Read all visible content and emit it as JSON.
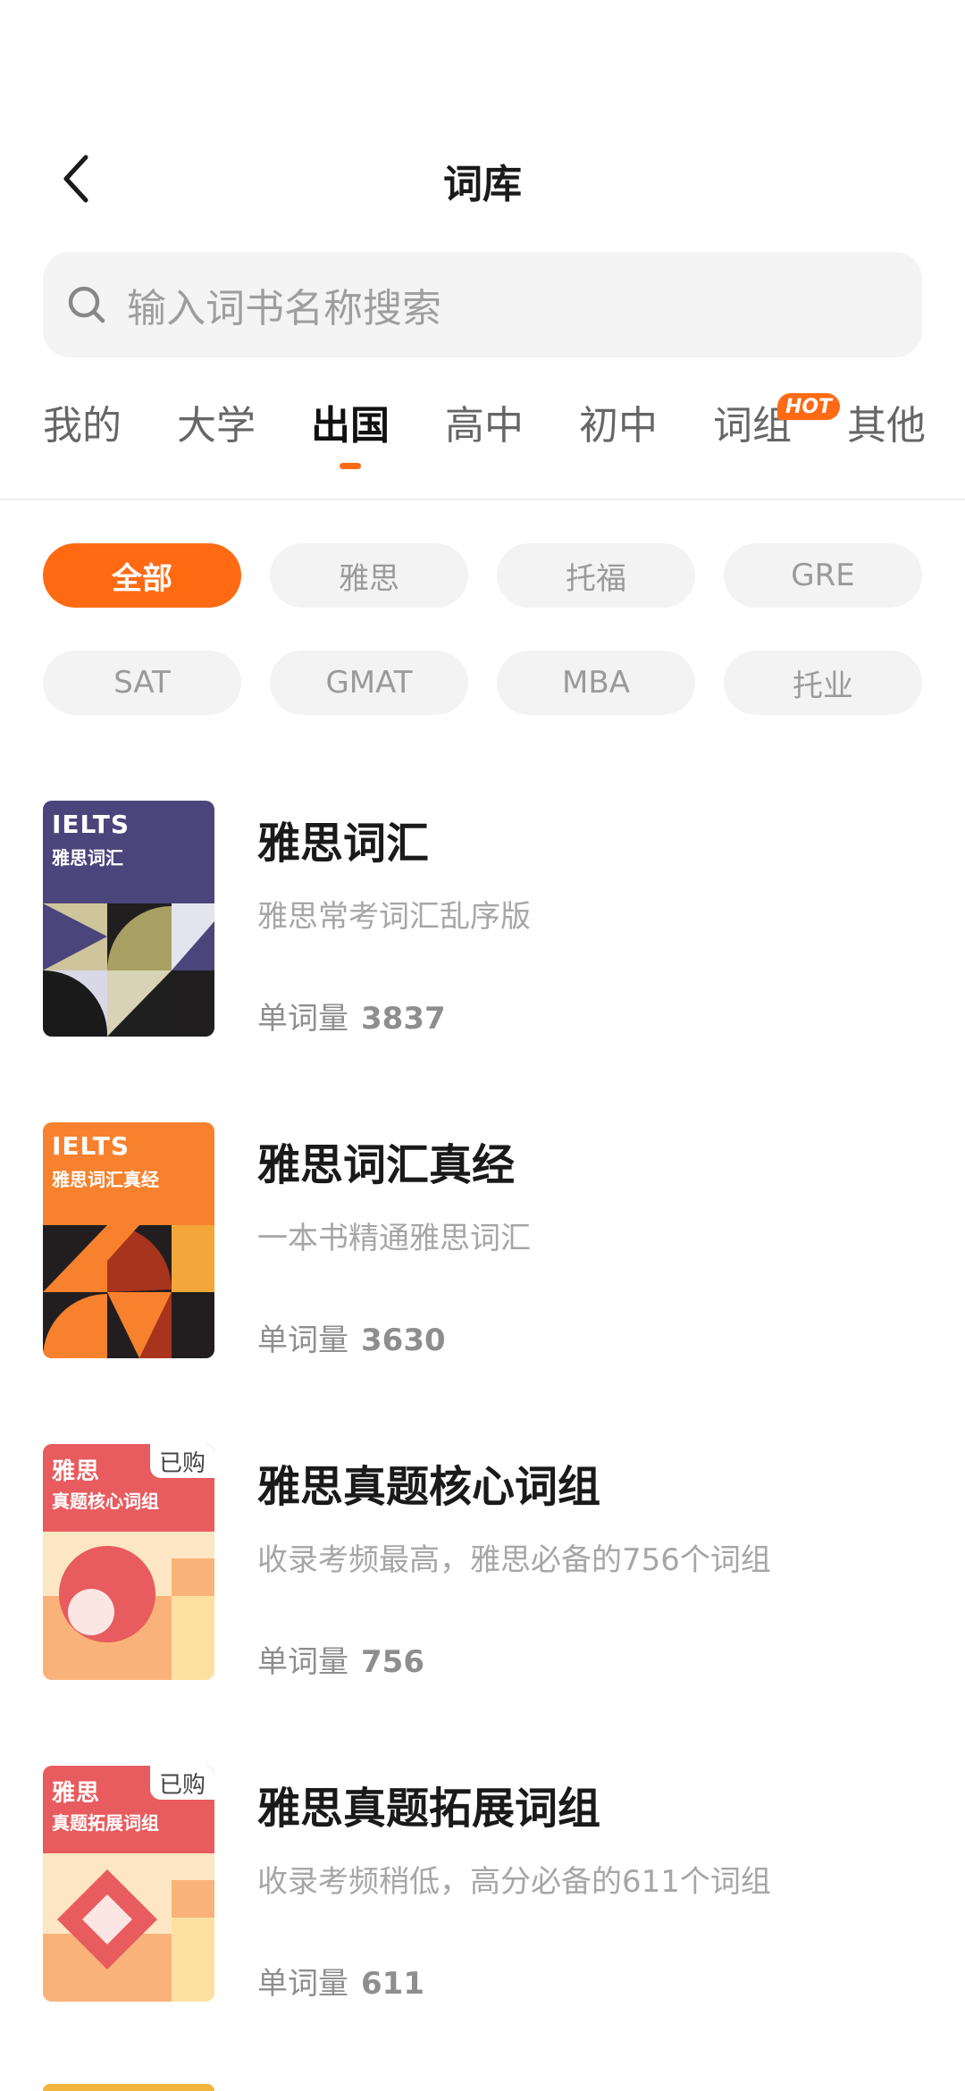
{
  "header": {
    "title": "词库",
    "back_icon": "chevron-left-icon"
  },
  "search": {
    "placeholder": "输入词书名称搜索",
    "icon": "search-icon"
  },
  "tabs": [
    {
      "label": "我的"
    },
    {
      "label": "大学"
    },
    {
      "label": "出国",
      "active": true
    },
    {
      "label": "高中"
    },
    {
      "label": "初中"
    },
    {
      "label": "词组",
      "badge": "HOT"
    },
    {
      "label": "其他"
    }
  ],
  "chips": [
    {
      "label": "全部",
      "active": true
    },
    {
      "label": "雅思"
    },
    {
      "label": "托福"
    },
    {
      "label": "GRE"
    },
    {
      "label": "SAT"
    },
    {
      "label": "GMAT"
    },
    {
      "label": "MBA"
    },
    {
      "label": "托业"
    }
  ],
  "count_label": "单词量",
  "books": [
    {
      "cover_title": "IELTS",
      "cover_subtitle": "雅思词汇",
      "title": "雅思词汇",
      "desc": "雅思常考词汇乱序版",
      "count": "3837",
      "purchased": false,
      "color": "#4b457c"
    },
    {
      "cover_title": "IELTS",
      "cover_subtitle": "雅思词汇真经",
      "title": "雅思词汇真经",
      "desc": "一本书精通雅思词汇",
      "count": "3630",
      "purchased": false,
      "color": "#f7812d"
    },
    {
      "cover_title": "雅思",
      "cover_subtitle": "真题核心词组",
      "title": "雅思真题核心词组",
      "desc": "收录考频最高，雅思必备的756个词组",
      "count": "756",
      "purchased": true,
      "purchased_label": "已购",
      "color": "#e85b5e"
    },
    {
      "cover_title": "雅思",
      "cover_subtitle": "真题拓展词组",
      "title": "雅思真题拓展词组",
      "desc": "收录考频稍低，高分必备的611个词组",
      "count": "611",
      "purchased": true,
      "purchased_label": "已购",
      "color": "#e85b5e"
    }
  ],
  "colors": {
    "accent": "#ff6a13"
  }
}
